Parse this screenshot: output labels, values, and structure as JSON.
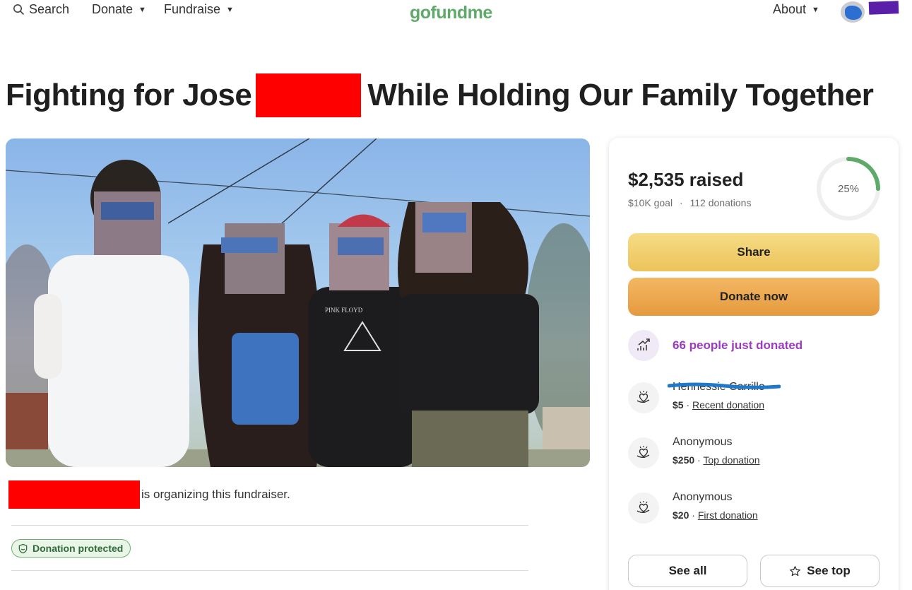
{
  "nav": {
    "search_label": "Search",
    "donate_label": "Donate",
    "fundraise_label": "Fundraise",
    "about_label": "About",
    "logo_text": "gofundme",
    "icons": [
      "search-icon",
      "chevron-down-icon",
      "avatar"
    ]
  },
  "campaign": {
    "title_part1": "Fighting for Jose",
    "title_part2": "While Holding Our Family Together",
    "organizer_text": "is organizing this fundraiser.",
    "protected_label": "Donation protected"
  },
  "stats": {
    "raised": "$2,535 raised",
    "goal": "$10K goal",
    "separator": "·",
    "donations": "112 donations",
    "percent_label": "25%",
    "percent_value": 25
  },
  "actions": {
    "share_label": "Share",
    "donate_now_label": "Donate now",
    "see_all_label": "See all",
    "see_top_label": "See top"
  },
  "activity": {
    "trend_text": "66 people just donated"
  },
  "donations": [
    {
      "name": "Hennessie Carrillo",
      "amount": "$5",
      "type": "Recent donation"
    },
    {
      "name": "Anonymous",
      "amount": "$250",
      "type": "Top donation"
    },
    {
      "name": "Anonymous",
      "amount": "$20",
      "type": "First donation"
    }
  ],
  "pink_floyd_shirt_text": "PINK FLOYD",
  "colors": {
    "brand_green": "#5fa96b",
    "share_yellow": "#ecc35a",
    "donate_orange": "#e69a3e",
    "trend_purple": "#9b3bc0",
    "redaction_red": "#ff0000"
  }
}
